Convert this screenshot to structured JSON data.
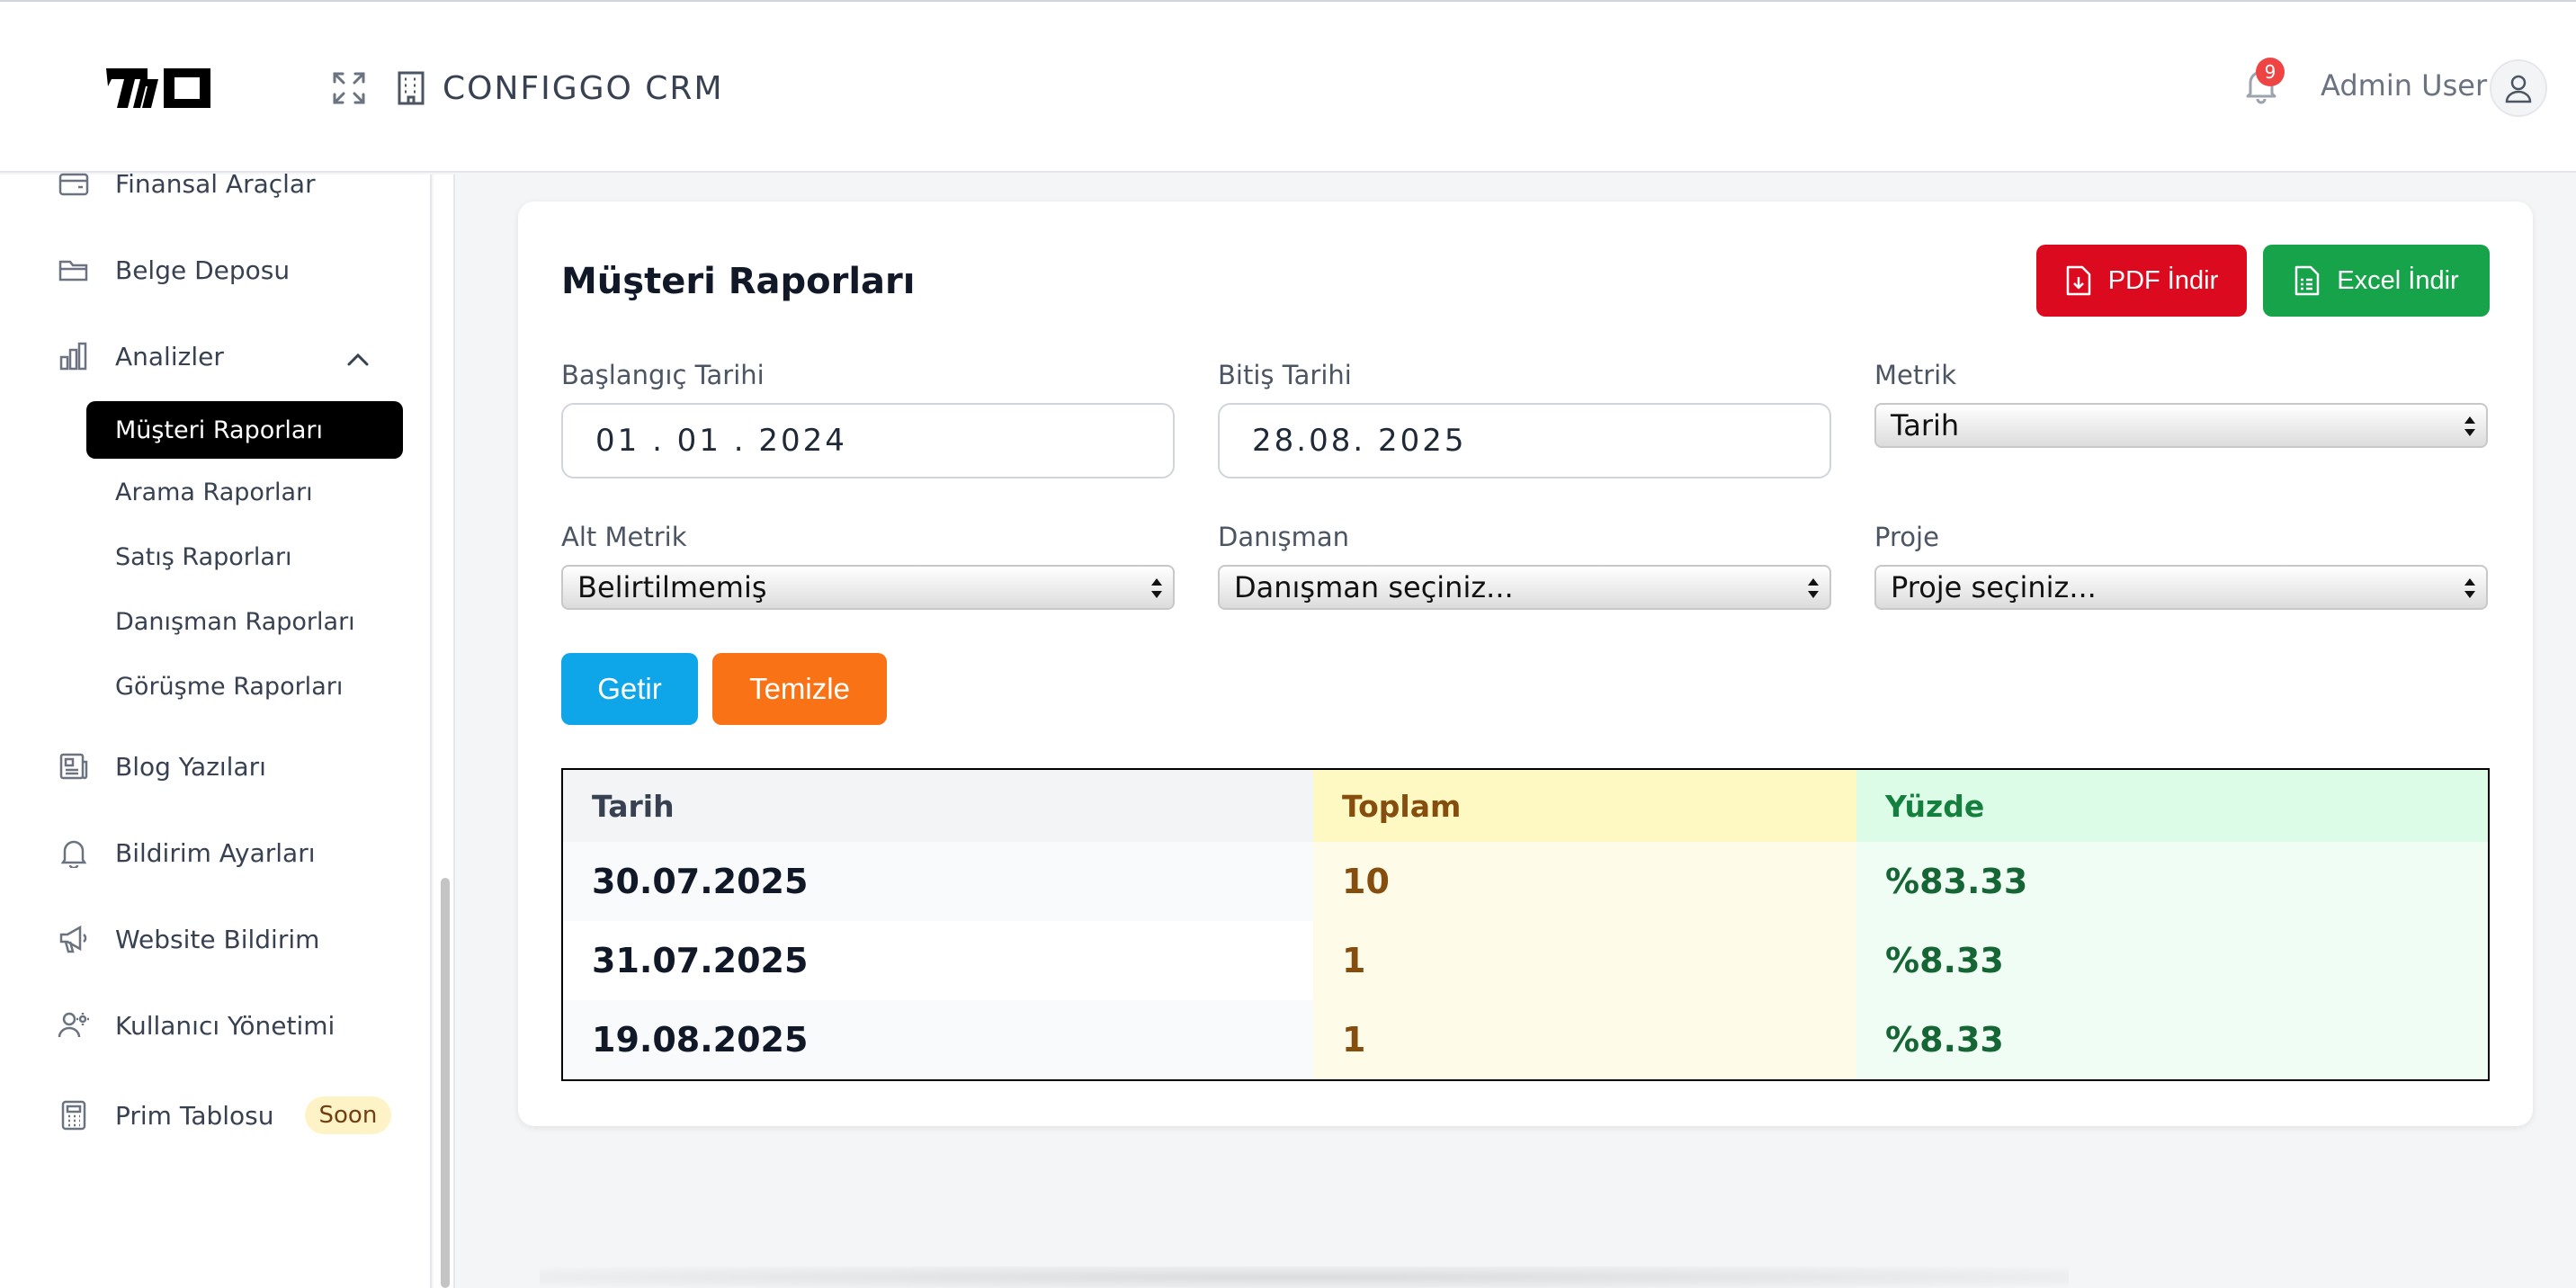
{
  "header": {
    "brand": "CONFIGGO  CRM",
    "notification_count": "9",
    "user_name": "Admin User"
  },
  "sidebar": {
    "items": [
      {
        "label": "Finansal Araçlar",
        "icon": "wallet-icon"
      },
      {
        "label": "Belge Deposu",
        "icon": "folder-icon"
      },
      {
        "label": "Analizler",
        "icon": "bar-chart-icon"
      },
      {
        "label": "Blog Yazıları",
        "icon": "newspaper-icon"
      },
      {
        "label": "Bildirim Ayarları",
        "icon": "bell-icon"
      },
      {
        "label": "Website Bildirim",
        "icon": "megaphone-icon"
      },
      {
        "label": "Kullanıcı Yönetimi",
        "icon": "user-manage-icon"
      },
      {
        "label": "Prim Tablosu",
        "icon": "calculator-icon",
        "badge": "Soon"
      }
    ],
    "sub_items": [
      {
        "label": "Müşteri Raporları",
        "active": true
      },
      {
        "label": "Arama Raporları"
      },
      {
        "label": "Satış Raporları"
      },
      {
        "label": "Danışman Raporları"
      },
      {
        "label": "Görüşme Raporları"
      }
    ]
  },
  "main": {
    "title": "Müşteri Raporları",
    "pdf_label": "PDF İndir",
    "excel_label": "Excel İndir",
    "filters": {
      "start_label": "Başlangıç Tarihi",
      "start_value": "01 . 01 . 2024",
      "end_label": "Bitiş Tarihi",
      "end_value": "28.08. 2025",
      "metric_label": "Metrik",
      "metric_value": "Tarih",
      "submetric_label": "Alt Metrik",
      "submetric_value": "Belirtilmemiş",
      "advisor_label": "Danışman",
      "advisor_value": "Danışman seçiniz...",
      "project_label": "Proje",
      "project_value": "Proje seçiniz..."
    },
    "get_label": "Getir",
    "clear_label": "Temizle",
    "table": {
      "headers": [
        "Tarih",
        "Toplam",
        "Yüzde"
      ],
      "rows": [
        [
          "30.07.2025",
          "10",
          "%83.33"
        ],
        [
          "31.07.2025",
          "1",
          "%8.33"
        ],
        [
          "19.08.2025",
          "1",
          "%8.33"
        ]
      ]
    }
  },
  "colors": {
    "pdf": "#dc0a1e",
    "excel": "#16a34a",
    "getir": "#0ea5e9",
    "temizle": "#f97316",
    "active_nav": "#000000",
    "toplam_header_bg": "#fef9c3",
    "yuzde_header_bg": "#dcfce7"
  }
}
